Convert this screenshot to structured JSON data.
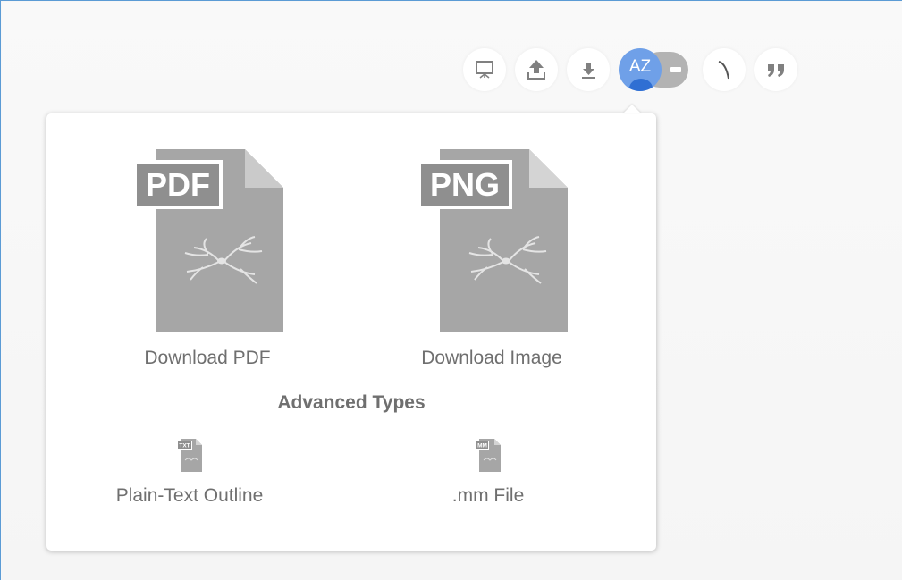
{
  "toolbar": {
    "buttons": [
      {
        "icon": "presentation-icon"
      },
      {
        "icon": "upload-icon"
      },
      {
        "icon": "download-icon"
      },
      {
        "icon": "toggle-switch"
      },
      {
        "icon": "curve-line-icon"
      },
      {
        "icon": "quote-icon"
      }
    ],
    "toggle_label": "AZ"
  },
  "popup": {
    "pdf": {
      "badge": "PDF",
      "label": "Download PDF"
    },
    "png": {
      "badge": "PNG",
      "label": "Download Image"
    },
    "advanced_title": "Advanced Types",
    "txt": {
      "badge": "TXT",
      "label": "Plain-Text Outline"
    },
    "mm": {
      "badge": "MM",
      "label": ".mm File"
    }
  },
  "colors": {
    "icon_gray": "#a6a6a6",
    "icon_dark": "#808080",
    "toggle_blue": "#6fa0e8",
    "toggle_track": "#b3b3b3",
    "text": "#6f6f6f",
    "frame_border": "#5b9bd5"
  }
}
